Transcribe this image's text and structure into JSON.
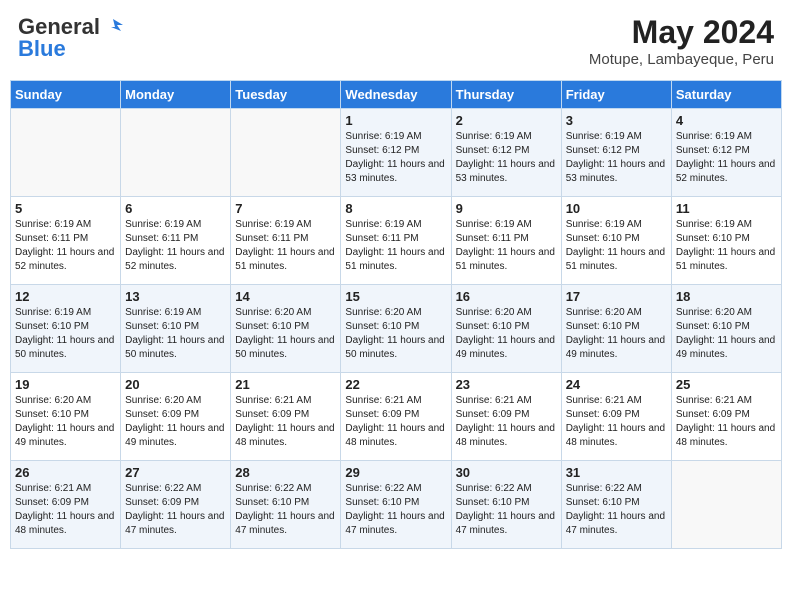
{
  "header": {
    "logo_general": "General",
    "logo_blue": "Blue",
    "month_title": "May 2024",
    "subtitle": "Motupe, Lambayeque, Peru"
  },
  "weekdays": [
    "Sunday",
    "Monday",
    "Tuesday",
    "Wednesday",
    "Thursday",
    "Friday",
    "Saturday"
  ],
  "weeks": [
    [
      {
        "day": "",
        "info": ""
      },
      {
        "day": "",
        "info": ""
      },
      {
        "day": "",
        "info": ""
      },
      {
        "day": "1",
        "info": "Sunrise: 6:19 AM\nSunset: 6:12 PM\nDaylight: 11 hours and 53 minutes."
      },
      {
        "day": "2",
        "info": "Sunrise: 6:19 AM\nSunset: 6:12 PM\nDaylight: 11 hours and 53 minutes."
      },
      {
        "day": "3",
        "info": "Sunrise: 6:19 AM\nSunset: 6:12 PM\nDaylight: 11 hours and 53 minutes."
      },
      {
        "day": "4",
        "info": "Sunrise: 6:19 AM\nSunset: 6:12 PM\nDaylight: 11 hours and 52 minutes."
      }
    ],
    [
      {
        "day": "5",
        "info": "Sunrise: 6:19 AM\nSunset: 6:11 PM\nDaylight: 11 hours and 52 minutes."
      },
      {
        "day": "6",
        "info": "Sunrise: 6:19 AM\nSunset: 6:11 PM\nDaylight: 11 hours and 52 minutes."
      },
      {
        "day": "7",
        "info": "Sunrise: 6:19 AM\nSunset: 6:11 PM\nDaylight: 11 hours and 51 minutes."
      },
      {
        "day": "8",
        "info": "Sunrise: 6:19 AM\nSunset: 6:11 PM\nDaylight: 11 hours and 51 minutes."
      },
      {
        "day": "9",
        "info": "Sunrise: 6:19 AM\nSunset: 6:11 PM\nDaylight: 11 hours and 51 minutes."
      },
      {
        "day": "10",
        "info": "Sunrise: 6:19 AM\nSunset: 6:10 PM\nDaylight: 11 hours and 51 minutes."
      },
      {
        "day": "11",
        "info": "Sunrise: 6:19 AM\nSunset: 6:10 PM\nDaylight: 11 hours and 51 minutes."
      }
    ],
    [
      {
        "day": "12",
        "info": "Sunrise: 6:19 AM\nSunset: 6:10 PM\nDaylight: 11 hours and 50 minutes."
      },
      {
        "day": "13",
        "info": "Sunrise: 6:19 AM\nSunset: 6:10 PM\nDaylight: 11 hours and 50 minutes."
      },
      {
        "day": "14",
        "info": "Sunrise: 6:20 AM\nSunset: 6:10 PM\nDaylight: 11 hours and 50 minutes."
      },
      {
        "day": "15",
        "info": "Sunrise: 6:20 AM\nSunset: 6:10 PM\nDaylight: 11 hours and 50 minutes."
      },
      {
        "day": "16",
        "info": "Sunrise: 6:20 AM\nSunset: 6:10 PM\nDaylight: 11 hours and 49 minutes."
      },
      {
        "day": "17",
        "info": "Sunrise: 6:20 AM\nSunset: 6:10 PM\nDaylight: 11 hours and 49 minutes."
      },
      {
        "day": "18",
        "info": "Sunrise: 6:20 AM\nSunset: 6:10 PM\nDaylight: 11 hours and 49 minutes."
      }
    ],
    [
      {
        "day": "19",
        "info": "Sunrise: 6:20 AM\nSunset: 6:10 PM\nDaylight: 11 hours and 49 minutes."
      },
      {
        "day": "20",
        "info": "Sunrise: 6:20 AM\nSunset: 6:09 PM\nDaylight: 11 hours and 49 minutes."
      },
      {
        "day": "21",
        "info": "Sunrise: 6:21 AM\nSunset: 6:09 PM\nDaylight: 11 hours and 48 minutes."
      },
      {
        "day": "22",
        "info": "Sunrise: 6:21 AM\nSunset: 6:09 PM\nDaylight: 11 hours and 48 minutes."
      },
      {
        "day": "23",
        "info": "Sunrise: 6:21 AM\nSunset: 6:09 PM\nDaylight: 11 hours and 48 minutes."
      },
      {
        "day": "24",
        "info": "Sunrise: 6:21 AM\nSunset: 6:09 PM\nDaylight: 11 hours and 48 minutes."
      },
      {
        "day": "25",
        "info": "Sunrise: 6:21 AM\nSunset: 6:09 PM\nDaylight: 11 hours and 48 minutes."
      }
    ],
    [
      {
        "day": "26",
        "info": "Sunrise: 6:21 AM\nSunset: 6:09 PM\nDaylight: 11 hours and 48 minutes."
      },
      {
        "day": "27",
        "info": "Sunrise: 6:22 AM\nSunset: 6:09 PM\nDaylight: 11 hours and 47 minutes."
      },
      {
        "day": "28",
        "info": "Sunrise: 6:22 AM\nSunset: 6:10 PM\nDaylight: 11 hours and 47 minutes."
      },
      {
        "day": "29",
        "info": "Sunrise: 6:22 AM\nSunset: 6:10 PM\nDaylight: 11 hours and 47 minutes."
      },
      {
        "day": "30",
        "info": "Sunrise: 6:22 AM\nSunset: 6:10 PM\nDaylight: 11 hours and 47 minutes."
      },
      {
        "day": "31",
        "info": "Sunrise: 6:22 AM\nSunset: 6:10 PM\nDaylight: 11 hours and 47 minutes."
      },
      {
        "day": "",
        "info": ""
      }
    ]
  ]
}
